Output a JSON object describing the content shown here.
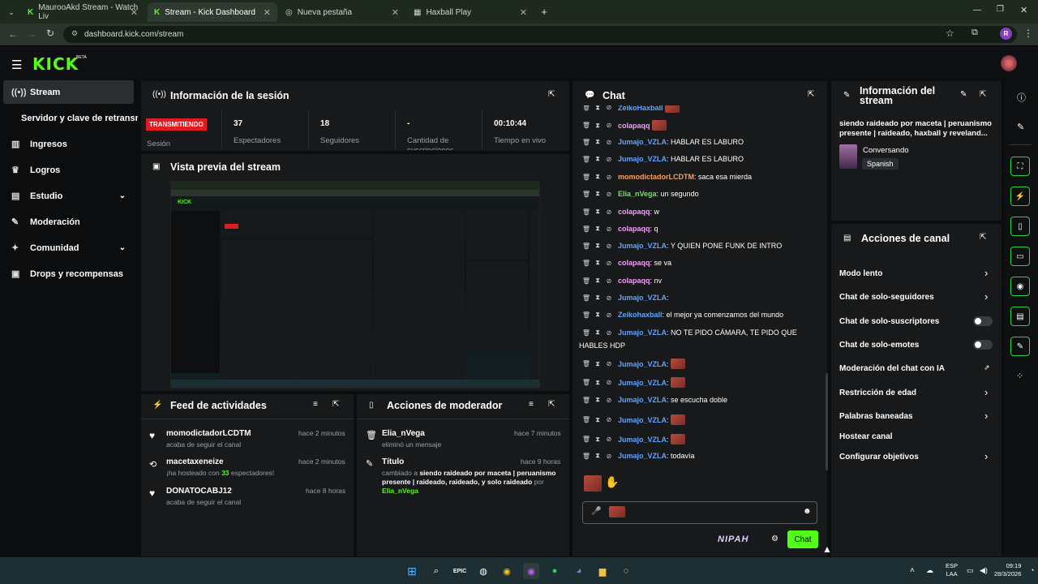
{
  "browser": {
    "tabs": [
      {
        "title": "MaurooAkd Stream - Watch Liv"
      },
      {
        "title": "Stream - Kick Dashboard"
      },
      {
        "title": "Nueva pestaña"
      },
      {
        "title": "Haxball Play"
      }
    ],
    "url": "dashboard.kick.com/stream",
    "profile_initial": "R"
  },
  "app": {
    "logo": "KICK",
    "logo_badge": "BETA"
  },
  "sidebar": {
    "items": [
      {
        "label": "Stream",
        "icon": "stream-icon"
      },
      {
        "label": "Servidor y clave de retransn",
        "icon": ""
      },
      {
        "label": "Ingresos",
        "icon": "chart-icon"
      },
      {
        "label": "Logros",
        "icon": "trophy-icon"
      },
      {
        "label": "Estudio",
        "icon": "studio-icon"
      },
      {
        "label": "Moderación",
        "icon": "wrench-icon"
      },
      {
        "label": "Comunidad",
        "icon": "community-icon"
      },
      {
        "label": "Drops y recompensas",
        "icon": "gift-icon"
      }
    ]
  },
  "session": {
    "title": "Información de la sesión",
    "status_badge": "TRANSMITIENDO",
    "status_label": "Sesión",
    "stats": [
      {
        "value": "37",
        "label": "Espectadores"
      },
      {
        "value": "18",
        "label": "Seguidores"
      },
      {
        "value": "-",
        "label": "Cantidad de suscripciones"
      },
      {
        "value": "00:10:44",
        "label": "Tiempo en vivo"
      }
    ]
  },
  "preview": {
    "title": "Vista previa del stream"
  },
  "activity": {
    "title": "Feed de actividades",
    "items": [
      {
        "user": "momodictadorLCDTM",
        "time": "hace 2 minutos",
        "desc": "acaba de seguir el canal",
        "icon": "heart-icon"
      },
      {
        "user": "macetaxeneize",
        "time": "hace 2 minutos",
        "desc_pre": "¡ha hosteado con ",
        "desc_count": "33",
        "desc_post": " espectadores!",
        "icon": "host-icon"
      },
      {
        "user": "DONATOCABJ12",
        "time": "hace 8 horas",
        "desc": "acaba de seguir el canal",
        "icon": "heart-icon"
      }
    ]
  },
  "mod_actions": {
    "title": "Acciones de moderador",
    "items": [
      {
        "user": "Elia_nVega",
        "time": "hace 7 minutos",
        "desc": "eliminó un mensaje"
      },
      {
        "user": "Título",
        "time": "hace 9 horas",
        "desc_pre": "cambiado a ",
        "desc_bold": "siendo raideado por maceta | peruanismo presente | raideado, raideado, y solo raideado",
        "desc_mid": " por ",
        "desc_user": "Elia_nVega"
      }
    ]
  },
  "chat": {
    "title": "Chat",
    "messages": [
      {
        "user": "ZeikoHaxball",
        "text": "",
        "emote": true
      },
      {
        "user": "colapaqq",
        "text": "",
        "emote": true
      },
      {
        "user": "Jumajo_VZLA",
        "text": ": HABLAR ES LABURO"
      },
      {
        "user": "Jumajo_VZLA",
        "text": ": HABLAR ES LABURO"
      },
      {
        "user": "momodictadorLCDTM",
        "text": ": saca esa mierda"
      },
      {
        "user": "Elia_nVega",
        "text": ": un segundo"
      },
      {
        "user": "colapaqq",
        "text": ": w"
      },
      {
        "user": "colapaqq",
        "text": ": q"
      },
      {
        "user": "Jumajo_VZLA",
        "text": ": Y QUIEN PONE FUNK DE INTRO"
      },
      {
        "user": "colapaqq",
        "text": ": se va"
      },
      {
        "user": "colapaqq",
        "text": ": nv"
      },
      {
        "user": "Jumajo_VZLA",
        "text": ":"
      },
      {
        "user": "Zeikohaxball",
        "text": ": el mejor ya comenzamos del mundo"
      },
      {
        "user": "Jumajo_VZLA",
        "text": ": NO TE PIDO CÁMARA, TE PIDO QUE"
      },
      {
        "user": "",
        "text": "HABLES HDP"
      },
      {
        "user": "Jumajo_VZLA",
        "text": ":",
        "emote": true
      },
      {
        "user": "Jumajo_VZLA",
        "text": ":",
        "emote": true
      },
      {
        "user": "Jumajo_VZLA",
        "text": ": se escucha doble"
      },
      {
        "user": "Jumajo_VZLA",
        "text": ":",
        "emote": true
      },
      {
        "user": "Jumajo_VZLA",
        "text": ":",
        "emote": true
      },
      {
        "user": "Jumajo_VZLA",
        "text": ": todavía"
      }
    ],
    "send_label": "Chat",
    "brand_tag": "NIPAH"
  },
  "stream_info": {
    "title": "Información del stream",
    "stream_title": "siendo raideado por maceta | peruanismo presente | raideado, haxball y reveland...",
    "category": "Conversando",
    "language": "Spanish"
  },
  "channel_actions": {
    "title": "Acciones de canal",
    "items": [
      {
        "label": "Modo lento",
        "control": "chevron"
      },
      {
        "label": "Chat de solo-seguidores",
        "control": "chevron"
      },
      {
        "label": "Chat de solo-suscriptores",
        "control": "toggle"
      },
      {
        "label": "Chat de solo-emotes",
        "control": "toggle"
      },
      {
        "label": "Moderación del chat con IA",
        "control": "external"
      },
      {
        "label": "Restricción de edad",
        "control": "chevron"
      },
      {
        "label": "Palabras baneadas",
        "control": "chevron"
      },
      {
        "label": "Hostear canal",
        "control": "none"
      },
      {
        "label": "Configurar objetivos",
        "control": "chevron"
      }
    ]
  },
  "taskbar": {
    "lang": "ESP",
    "region": "LAA",
    "time": "09:19",
    "date": "28/3/2026"
  },
  "colors": {
    "accent": "#53fc18",
    "live_red": "#e01b22",
    "panel": "#17191b"
  }
}
